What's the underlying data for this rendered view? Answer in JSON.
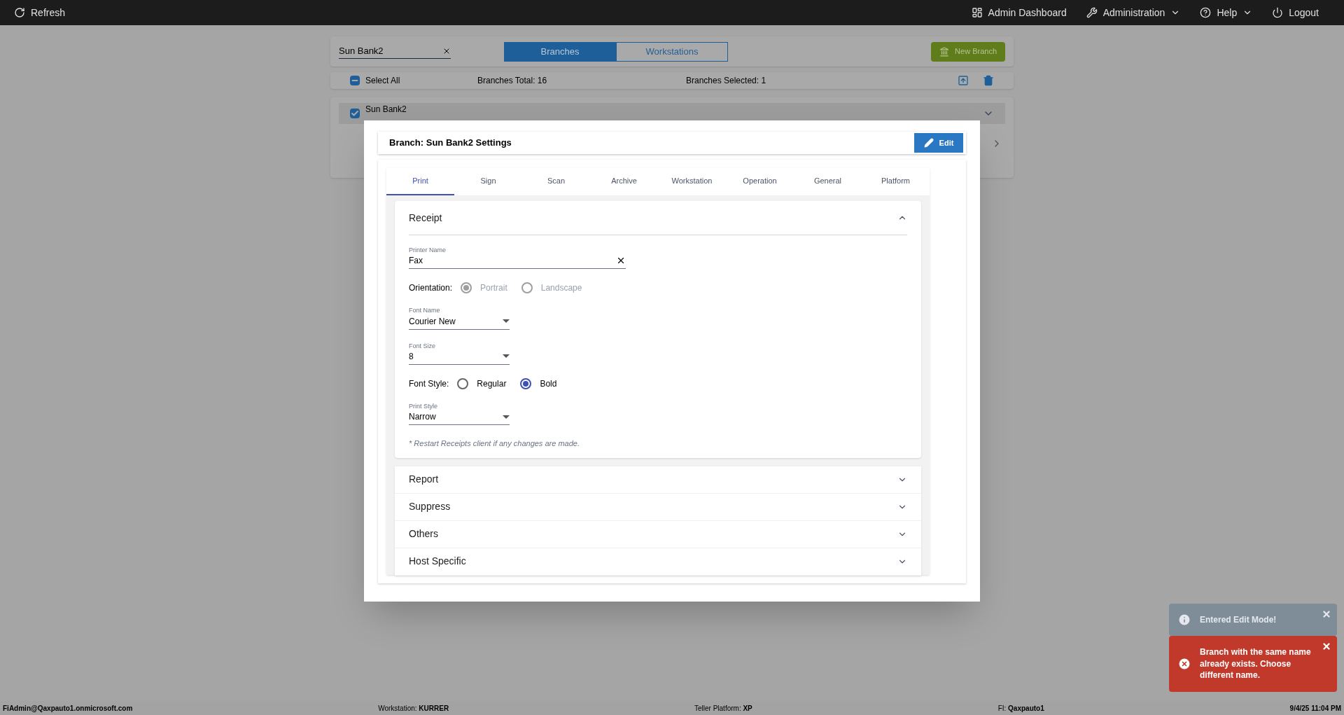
{
  "top_bar": {
    "refresh": "Refresh",
    "menu": [
      {
        "label": "Admin Dashboard",
        "kind": "link"
      },
      {
        "label": "Administration",
        "kind": "dropdown"
      },
      {
        "label": "Help",
        "kind": "dropdown"
      },
      {
        "label": "Logout",
        "kind": "link"
      }
    ]
  },
  "toolbar": {
    "search_value": "Sun Bank2",
    "view_tabs": [
      {
        "label": "Branches",
        "selected": true
      },
      {
        "label": "Workstations",
        "selected": false
      }
    ],
    "new_button": "New Branch"
  },
  "selection_bar": {
    "select_all": "Select All",
    "indeterminate": true,
    "total": "Branches Total: 16",
    "selected_count": "Branches Selected: 1"
  },
  "list": [
    {
      "name": "Sun Bank2",
      "checked": true
    }
  ],
  "dialog": {
    "title": "Branch: Sun Bank2 Settings",
    "edit_button": "Edit",
    "tabs": [
      {
        "label": "Print",
        "selected": true
      },
      {
        "label": "Sign",
        "selected": false
      },
      {
        "label": "Scan",
        "selected": false
      },
      {
        "label": "Archive",
        "selected": false
      },
      {
        "label": "Workstation",
        "selected": false
      },
      {
        "label": "Operation",
        "selected": false
      },
      {
        "label": "General",
        "selected": false
      },
      {
        "label": "Platform",
        "selected": false
      }
    ],
    "sections": [
      {
        "title": "Receipt",
        "expanded": true,
        "fields": [
          {
            "kind": "text",
            "label": "Printer Name",
            "value": "Fax"
          },
          {
            "kind": "radio",
            "label": "Orientation:",
            "disabled": true,
            "options": [
              {
                "label": "Portrait",
                "selected": true
              },
              {
                "label": "Landscape",
                "selected": false
              }
            ]
          },
          {
            "kind": "select",
            "label": "Font Name",
            "value": "Courier New"
          },
          {
            "kind": "select",
            "label": "Font Size",
            "value": "8"
          },
          {
            "kind": "radio",
            "label": "Font Style:",
            "disabled": false,
            "options": [
              {
                "label": "Regular",
                "selected": false
              },
              {
                "label": "Bold",
                "selected": true
              }
            ]
          },
          {
            "kind": "select",
            "label": "Print Style",
            "value": "Narrow"
          },
          {
            "kind": "note",
            "text": "* Restart Receipts client if any changes are made."
          }
        ]
      },
      {
        "title": "Report",
        "expanded": false
      },
      {
        "title": "Suppress",
        "expanded": false
      },
      {
        "title": "Others",
        "expanded": false
      },
      {
        "title": "Host Specific",
        "expanded": false
      }
    ]
  },
  "toasts": [
    {
      "kind": "info",
      "text": "Entered Edit Mode!"
    },
    {
      "kind": "error",
      "text": "Branch with the same name already exists. Choose different name."
    }
  ],
  "status_bar": [
    {
      "value": "FiAdmin@Qaxpauto1.onmicrosoft.com"
    },
    {
      "label": "Workstation:",
      "value": "KURRER"
    },
    {
      "label": "Teller Platform:",
      "value": "XP"
    },
    {
      "label": "FI:",
      "value": "Qaxpauto1"
    },
    {
      "value": "9/4/25 11:04 PM"
    }
  ]
}
